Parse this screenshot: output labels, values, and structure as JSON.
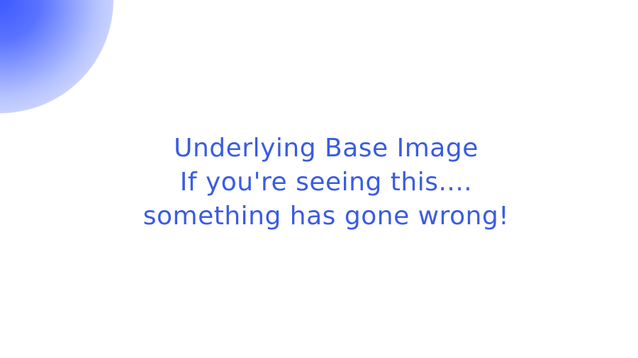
{
  "message": {
    "lines": [
      "Underlying Base Image",
      "If you're seeing this....",
      "something has gone wrong!"
    ]
  },
  "colors": {
    "text": "#3a5ce0",
    "glow": "#3c5aff",
    "background": "#ffffff"
  }
}
